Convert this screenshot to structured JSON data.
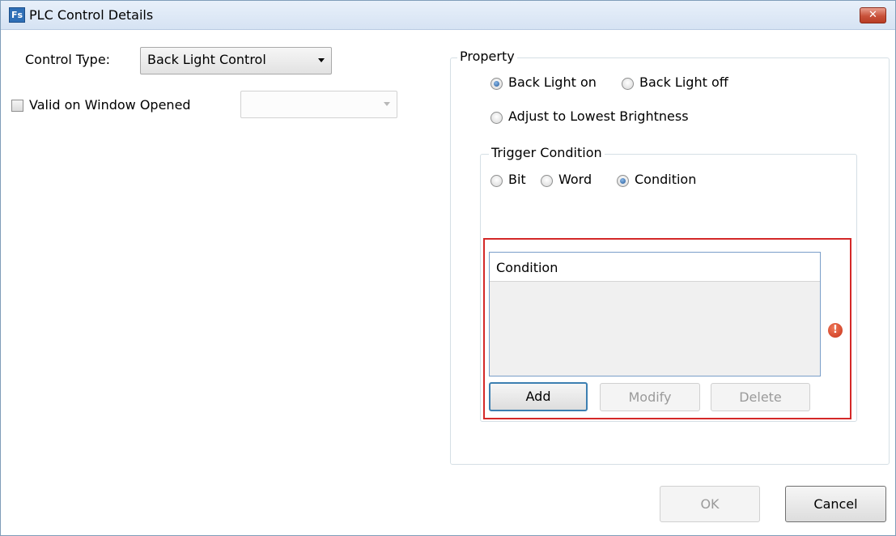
{
  "window": {
    "title": "PLC Control Details",
    "app_icon_text": "Fs",
    "close_glyph": "✕"
  },
  "left_panel": {
    "control_type_label": "Control Type:",
    "control_type_value": "Back Light Control",
    "valid_on_window_label": "Valid on Window Opened",
    "valid_on_window_checked": false,
    "valid_on_window_select_value": ""
  },
  "property": {
    "title": "Property",
    "options": [
      {
        "label": "Back Light on",
        "checked": true
      },
      {
        "label": "Back Light off",
        "checked": false
      },
      {
        "label": "Adjust to Lowest Brightness",
        "checked": false
      }
    ],
    "trigger": {
      "title": "Trigger Condition",
      "options": [
        {
          "label": "Bit",
          "checked": false
        },
        {
          "label": "Word",
          "checked": false
        },
        {
          "label": "Condition",
          "checked": true
        }
      ],
      "list_header": "Condition",
      "rows": [],
      "buttons": {
        "add": "Add",
        "modify": "Modify",
        "delete": "Delete"
      },
      "error_glyph": "!"
    }
  },
  "footer": {
    "ok": "OK",
    "cancel": "Cancel"
  },
  "colors": {
    "highlight_border": "#d42828",
    "error_icon": "#c8321a",
    "default_button_border": "#3c7fb1"
  }
}
